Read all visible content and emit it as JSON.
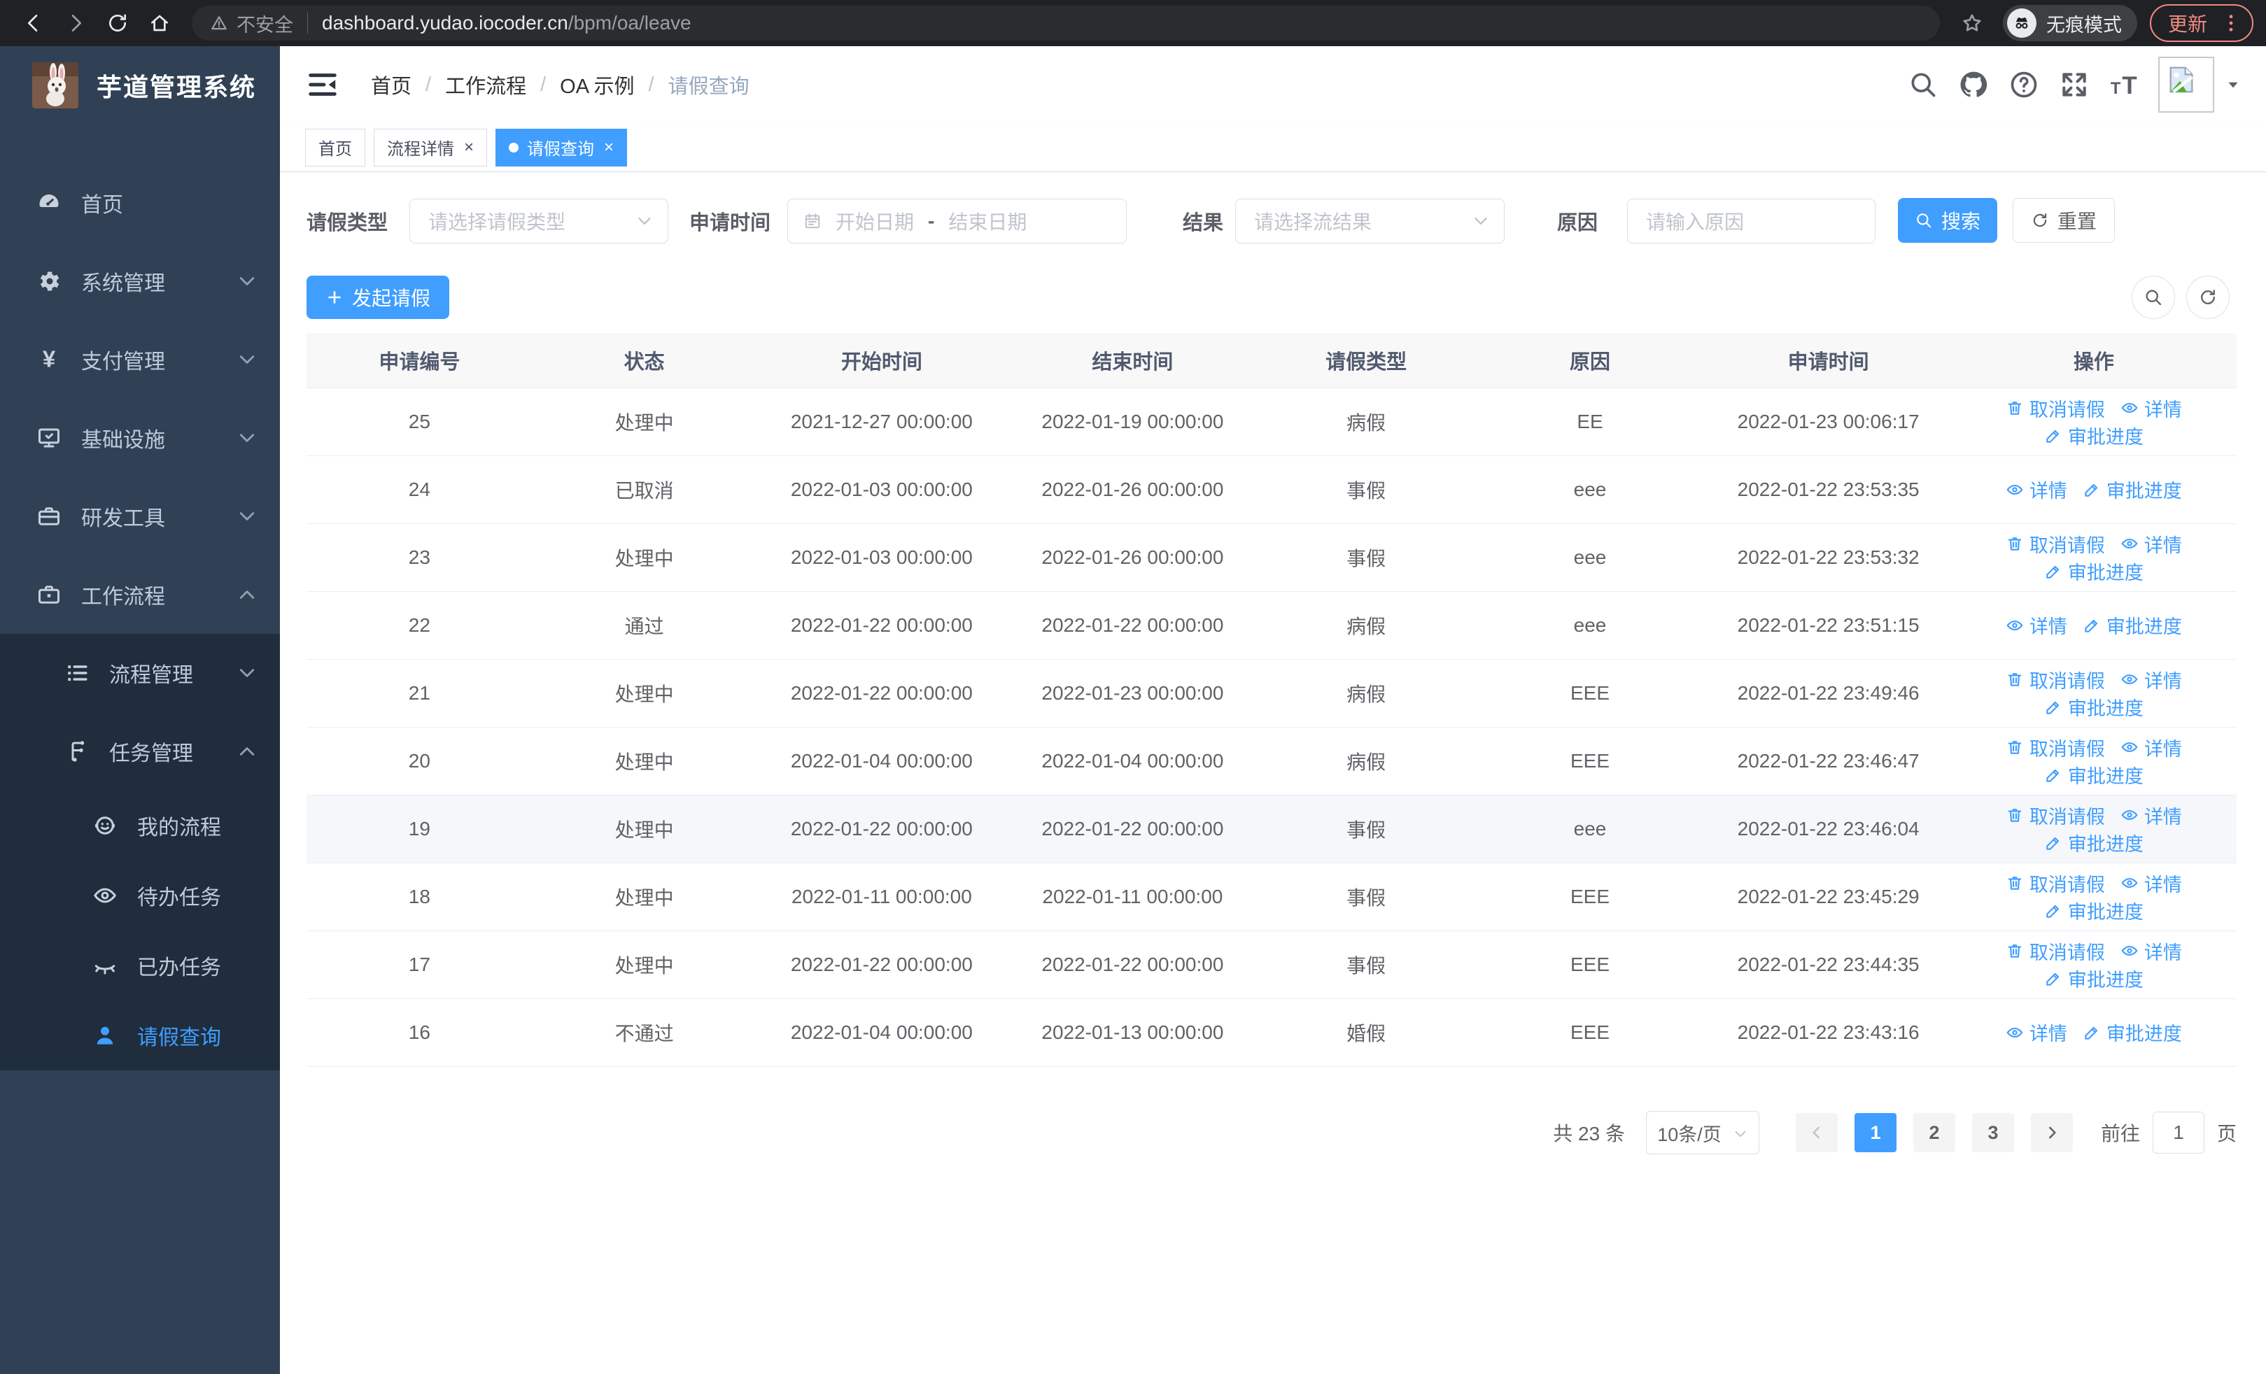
{
  "browser": {
    "security_label": "不安全",
    "url_host": "dashboard.yudao.iocoder.cn",
    "url_path": "/bpm/oa/leave",
    "incognito_label": "无痕模式",
    "update_label": "更新"
  },
  "sidebar": {
    "title": "芋道管理系统",
    "logo_icon": "rabbit-logo",
    "items": [
      {
        "key": "home",
        "label": "首页",
        "icon": "dashboard-icon",
        "level": 1
      },
      {
        "key": "system",
        "label": "系统管理",
        "icon": "gear-icon",
        "level": 1,
        "chevron": "down"
      },
      {
        "key": "payment",
        "label": "支付管理",
        "icon": "payment-icon",
        "level": 1,
        "chevron": "down"
      },
      {
        "key": "infra",
        "label": "基础设施",
        "icon": "infrastructure-icon",
        "level": 1,
        "chevron": "down"
      },
      {
        "key": "devtools",
        "label": "研发工具",
        "icon": "devtools-icon",
        "level": 1,
        "chevron": "down"
      },
      {
        "key": "workflow",
        "label": "工作流程",
        "icon": "workflow-icon",
        "level": 1,
        "chevron": "up"
      },
      {
        "key": "process-mgmt",
        "label": "流程管理",
        "icon": "process-icon",
        "level": 2,
        "chevron": "down",
        "dark": true
      },
      {
        "key": "task-mgmt",
        "label": "任务管理",
        "icon": "task-icon",
        "level": 2,
        "chevron": "up",
        "dark": true
      },
      {
        "key": "my-process",
        "label": "我的流程",
        "icon": "my-process-icon",
        "level": 3,
        "dark": true
      },
      {
        "key": "todo-tasks",
        "label": "待办任务",
        "icon": "eye-open-icon",
        "level": 3,
        "dark": true
      },
      {
        "key": "done-tasks",
        "label": "已办任务",
        "icon": "eye-closed-icon",
        "level": 3,
        "dark": true
      },
      {
        "key": "leave-query",
        "label": "请假查询",
        "icon": "user-icon",
        "level": 3,
        "dark": true,
        "active": true
      }
    ]
  },
  "header": {
    "breadcrumb": [
      {
        "label": "首页"
      },
      {
        "label": "工作流程"
      },
      {
        "label": "OA 示例"
      },
      {
        "label": "请假查询",
        "current": true
      }
    ],
    "tools": [
      "search-icon",
      "github-icon",
      "help-icon",
      "fullscreen-icon",
      "font-size-icon"
    ]
  },
  "tabs": [
    {
      "label": "首页"
    },
    {
      "label": "流程详情",
      "closable": true
    },
    {
      "label": "请假查询",
      "closable": true,
      "active": true
    }
  ],
  "filters": {
    "leave_type": {
      "label": "请假类型",
      "placeholder": "请选择请假类型"
    },
    "apply_time": {
      "label": "申请时间",
      "start_placeholder": "开始日期",
      "separator": "-",
      "end_placeholder": "结束日期"
    },
    "result": {
      "label": "结果",
      "placeholder": "请选择流结果"
    },
    "reason": {
      "label": "原因",
      "placeholder": "请输入原因"
    },
    "search_label": "搜索",
    "reset_label": "重置"
  },
  "toolbar": {
    "create_label": "发起请假"
  },
  "table": {
    "columns": [
      "申请编号",
      "状态",
      "开始时间",
      "结束时间",
      "请假类型",
      "原因",
      "申请时间",
      "操作"
    ],
    "action_labels": {
      "cancel": "取消请假",
      "detail": "详情",
      "progress": "审批进度"
    },
    "rows": [
      {
        "id": "25",
        "status": "处理中",
        "start": "2021-12-27 00:00:00",
        "end": "2022-01-19 00:00:00",
        "type": "病假",
        "reason": "EE",
        "applied": "2022-01-23 00:06:17",
        "actions": [
          "cancel",
          "detail",
          "progress"
        ]
      },
      {
        "id": "24",
        "status": "已取消",
        "start": "2022-01-03 00:00:00",
        "end": "2022-01-26 00:00:00",
        "type": "事假",
        "reason": "eee",
        "applied": "2022-01-22 23:53:35",
        "actions": [
          "detail",
          "progress"
        ]
      },
      {
        "id": "23",
        "status": "处理中",
        "start": "2022-01-03 00:00:00",
        "end": "2022-01-26 00:00:00",
        "type": "事假",
        "reason": "eee",
        "applied": "2022-01-22 23:53:32",
        "actions": [
          "cancel",
          "detail",
          "progress"
        ]
      },
      {
        "id": "22",
        "status": "通过",
        "start": "2022-01-22 00:00:00",
        "end": "2022-01-22 00:00:00",
        "type": "病假",
        "reason": "eee",
        "applied": "2022-01-22 23:51:15",
        "actions": [
          "detail",
          "progress"
        ]
      },
      {
        "id": "21",
        "status": "处理中",
        "start": "2022-01-22 00:00:00",
        "end": "2022-01-23 00:00:00",
        "type": "病假",
        "reason": "EEE",
        "applied": "2022-01-22 23:49:46",
        "actions": [
          "cancel",
          "detail",
          "progress"
        ]
      },
      {
        "id": "20",
        "status": "处理中",
        "start": "2022-01-04 00:00:00",
        "end": "2022-01-04 00:00:00",
        "type": "病假",
        "reason": "EEE",
        "applied": "2022-01-22 23:46:47",
        "actions": [
          "cancel",
          "detail",
          "progress"
        ]
      },
      {
        "id": "19",
        "status": "处理中",
        "start": "2022-01-22 00:00:00",
        "end": "2022-01-22 00:00:00",
        "type": "事假",
        "reason": "eee",
        "applied": "2022-01-22 23:46:04",
        "actions": [
          "cancel",
          "detail",
          "progress"
        ],
        "hover": true
      },
      {
        "id": "18",
        "status": "处理中",
        "start": "2022-01-11 00:00:00",
        "end": "2022-01-11 00:00:00",
        "type": "事假",
        "reason": "EEE",
        "applied": "2022-01-22 23:45:29",
        "actions": [
          "cancel",
          "detail",
          "progress"
        ]
      },
      {
        "id": "17",
        "status": "处理中",
        "start": "2022-01-22 00:00:00",
        "end": "2022-01-22 00:00:00",
        "type": "事假",
        "reason": "EEE",
        "applied": "2022-01-22 23:44:35",
        "actions": [
          "cancel",
          "detail",
          "progress"
        ]
      },
      {
        "id": "16",
        "status": "不通过",
        "start": "2022-01-04 00:00:00",
        "end": "2022-01-13 00:00:00",
        "type": "婚假",
        "reason": "EEE",
        "applied": "2022-01-22 23:43:16",
        "actions": [
          "detail",
          "progress"
        ]
      }
    ]
  },
  "pagination": {
    "total": "共 23 条",
    "page_size": "10条/页",
    "pages": [
      "1",
      "2",
      "3"
    ],
    "active_page": "1",
    "goto_label": "前往",
    "goto_value": "1",
    "unit": "页"
  },
  "colors": {
    "accent": "#409eff",
    "sidebar": "#304156",
    "submenu": "#1f2d3d",
    "update_red": "#ef8b82"
  }
}
